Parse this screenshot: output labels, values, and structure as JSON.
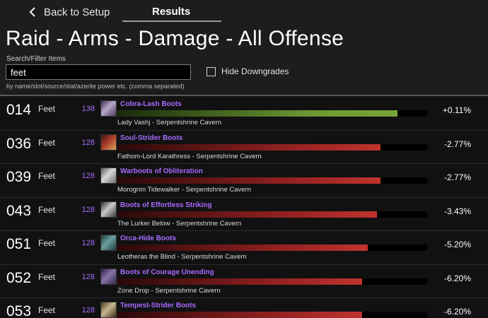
{
  "nav": {
    "back_label": "Back to Setup",
    "results_label": "Results"
  },
  "header": {
    "title": "Raid - Arms - Damage - All Offense",
    "search_label": "Search/Filter Items",
    "search_value": "feet",
    "hide_downgrades_label": "Hide Downgrades",
    "search_hint": "by name/slot/source/stat/azerite power etc. (comma separated)"
  },
  "colors": {
    "accent_purple": "#a66cff",
    "upgrade_green": "#6b9a34",
    "downgrade_red": "#c0332e"
  },
  "items": [
    {
      "rank": "014",
      "slot": "Feet",
      "ilvl": "138",
      "name": "Cobra-Lash Boots",
      "source": "Lady Vashj - Serpentshrine Cavern",
      "delta": "+0.11%",
      "bar": 0.905,
      "kind": "green",
      "icon": "boot-icon"
    },
    {
      "rank": "036",
      "slot": "Feet",
      "ilvl": "128",
      "name": "Soul-Strider Boots",
      "source": "Fathom-Lord Karathress - Serpentshrine Cavern",
      "delta": "-2.77%",
      "bar": 0.85,
      "kind": "red",
      "icon": "boot-icon"
    },
    {
      "rank": "039",
      "slot": "Feet",
      "ilvl": "128",
      "name": "Warboots of Obliteration",
      "source": "Morogrim Tidewalker - Serpentshrine Cavern",
      "delta": "-2.77%",
      "bar": 0.85,
      "kind": "red",
      "icon": "boot-icon"
    },
    {
      "rank": "043",
      "slot": "Feet",
      "ilvl": "128",
      "name": "Boots of Effortless Striking",
      "source": "The Lurker Below - Serpentshrine Cavern",
      "delta": "-3.43%",
      "bar": 0.838,
      "kind": "red",
      "icon": "boot-icon"
    },
    {
      "rank": "051",
      "slot": "Feet",
      "ilvl": "128",
      "name": "Orca-Hide Boots",
      "source": "Leotheras the Blind - Serpentshrine Cavern",
      "delta": "-5.20%",
      "bar": 0.808,
      "kind": "red",
      "icon": "boot-icon"
    },
    {
      "rank": "052",
      "slot": "Feet",
      "ilvl": "128",
      "name": "Boots of Courage Unending",
      "source": "Zone Drop - Serpentshrine Cavern",
      "delta": "-6.20%",
      "bar": 0.79,
      "kind": "red",
      "icon": "boot-icon"
    },
    {
      "rank": "053",
      "slot": "Feet",
      "ilvl": "128",
      "name": "Tempest-Strider Boots",
      "source": "",
      "delta": "-6.20%",
      "bar": 0.79,
      "kind": "red",
      "icon": "boot-icon"
    }
  ]
}
